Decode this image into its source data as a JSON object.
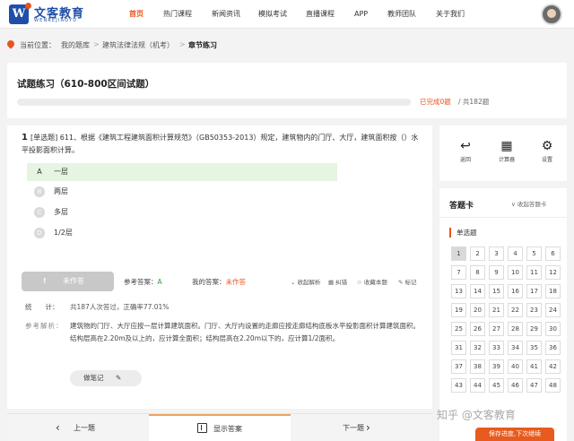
{
  "header": {
    "brand_name": "文客教育",
    "brand_sub": "WENKEJIAOYU",
    "nav": [
      "首页",
      "热门课程",
      "新闻资讯",
      "模拟考试",
      "直播课程",
      "APP",
      "教师团队",
      "关于我们"
    ],
    "active_nav": "首页"
  },
  "breadcrumb": {
    "items": [
      "当前位置：",
      "我的题库",
      "建筑法律法规（机考）",
      "章节练习"
    ],
    "separators": [
      ">",
      ">",
      ">"
    ]
  },
  "exercise": {
    "title": "试题练习（610-800区间试题）",
    "done_text": "已完成0题",
    "total_text": "/ 共182题",
    "progress_fraction": 0
  },
  "question": {
    "number": "1",
    "text": "[单选题] 611、根据《建筑工程建筑面积计算规范》（GB50353-2013）规定，建筑物内的门厅、大厅，建筑面积按（）水平投影面积计算。",
    "options": [
      {
        "letter": "A",
        "text": "一层"
      },
      {
        "letter": "B",
        "text": "两层"
      },
      {
        "letter": "C",
        "text": "多层"
      },
      {
        "letter": "D",
        "text": "1/2层"
      }
    ],
    "selected_option": "A"
  },
  "answer_bar": {
    "status_icon": "!",
    "status_label": "未作答",
    "ref_label": "参考答案：",
    "ref_value": "A",
    "my_label": "我的答案：",
    "my_value": "未作答",
    "tools": [
      {
        "icon": "chevron-down-icon",
        "glyph": "⌄",
        "label": "收起解析"
      },
      {
        "icon": "error-icon",
        "glyph": "▦",
        "label": "纠错"
      },
      {
        "icon": "star-icon",
        "glyph": "☆",
        "label": "收藏本题"
      },
      {
        "icon": "bookmark-icon",
        "glyph": "✎",
        "label": "标记"
      }
    ]
  },
  "stats": {
    "key": "统　　计：",
    "value": "共187人次答过，正确率77.01%"
  },
  "analysis": {
    "key": "参考解析：",
    "value": "建筑物的门厅、大厅应按一层计算建筑面积。门厅、大厅内设置的走廊应按走廊结构底板水平投影面积计算建筑面积。结构层高在2.20m及以上的，应计算全面积；结构层高在2.20m以下的，应计算1/2面积。"
  },
  "note_button": {
    "label": "做笔记",
    "icon": "pencil-icon"
  },
  "side_tools": [
    {
      "icon": "return-icon",
      "glyph": "↩",
      "label": "返回"
    },
    {
      "icon": "calculator-icon",
      "glyph": "▦",
      "label": "计算器"
    },
    {
      "icon": "gear-icon",
      "glyph": "⚙",
      "label": "设置"
    }
  ],
  "answer_card": {
    "title": "答题卡",
    "collapse_label": "∨ 收起答题卡",
    "section": "单选题",
    "current": 1,
    "numbers": [
      1,
      2,
      3,
      4,
      5,
      6,
      7,
      8,
      9,
      10,
      11,
      12,
      13,
      14,
      15,
      16,
      17,
      18,
      19,
      20,
      21,
      22,
      23,
      24,
      25,
      26,
      27,
      28,
      29,
      30,
      31,
      32,
      33,
      34,
      35,
      36,
      37,
      38,
      39,
      40,
      41,
      42,
      43,
      44,
      45,
      46,
      47,
      48
    ]
  },
  "continue_button": "保存进度,下次继续",
  "bottom_bar": {
    "prev": "上一题",
    "show_answer": "显示答案",
    "next": "下一题"
  },
  "watermark": "知乎 @文客教育"
}
